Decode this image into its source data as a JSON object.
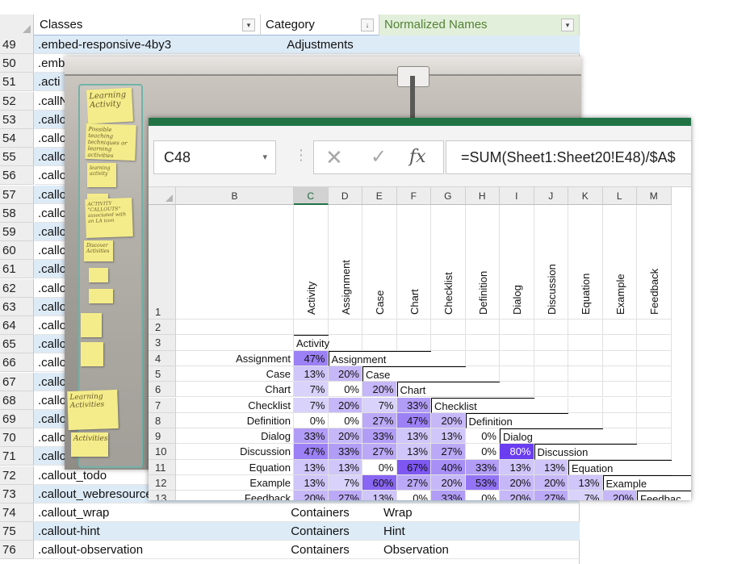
{
  "back_sheet": {
    "headers": {
      "classes": "Classes",
      "category": "Category",
      "normalized": "Normalized Names",
      "filter_icon": "▾",
      "sorted_filter_icon": "↓"
    },
    "rows": [
      {
        "num": "49",
        "cls": ".embed-responsive-4by3",
        "cat": "Adjustments",
        "norm": ""
      },
      {
        "num": "50",
        "cls": ".emb",
        "cat": "",
        "norm": ""
      },
      {
        "num": "51",
        "cls": ".acti",
        "cat": "",
        "norm": ""
      },
      {
        "num": "52",
        "cls": ".callN",
        "cat": "",
        "norm": ""
      },
      {
        "num": "53",
        "cls": ".callo",
        "cat": "",
        "norm": ""
      },
      {
        "num": "54",
        "cls": ".callo",
        "cat": "",
        "norm": ""
      },
      {
        "num": "55",
        "cls": ".callo",
        "cat": "",
        "norm": ""
      },
      {
        "num": "56",
        "cls": ".callo",
        "cat": "",
        "norm": ""
      },
      {
        "num": "57",
        "cls": ".callo",
        "cat": "",
        "norm": ""
      },
      {
        "num": "58",
        "cls": ".callo",
        "cat": "",
        "norm": ""
      },
      {
        "num": "59",
        "cls": ".callo",
        "cat": "",
        "norm": ""
      },
      {
        "num": "60",
        "cls": ".callo",
        "cat": "",
        "norm": ""
      },
      {
        "num": "61",
        "cls": ".callo",
        "cat": "",
        "norm": ""
      },
      {
        "num": "62",
        "cls": ".callo",
        "cat": "",
        "norm": ""
      },
      {
        "num": "63",
        "cls": ".callo",
        "cat": "",
        "norm": ""
      },
      {
        "num": "64",
        "cls": ".callo",
        "cat": "",
        "norm": ""
      },
      {
        "num": "65",
        "cls": ".callo",
        "cat": "",
        "norm": ""
      },
      {
        "num": "66",
        "cls": ".callo",
        "cat": "",
        "norm": ""
      },
      {
        "num": "67",
        "cls": ".callo",
        "cat": "",
        "norm": ""
      },
      {
        "num": "68",
        "cls": ".callo",
        "cat": "",
        "norm": ""
      },
      {
        "num": "69",
        "cls": ".callo",
        "cat": "",
        "norm": ""
      },
      {
        "num": "70",
        "cls": ".callo",
        "cat": "",
        "norm": ""
      },
      {
        "num": "71",
        "cls": ".callout_summary",
        "cat": "",
        "norm": ""
      },
      {
        "num": "72",
        "cls": ".callout_todo",
        "cat": "",
        "norm": ""
      },
      {
        "num": "73",
        "cls": ".callout_webresources",
        "cat": "",
        "norm": ""
      },
      {
        "num": "74",
        "cls": ".callout_wrap",
        "cat": "Containers",
        "norm": "Wrap"
      },
      {
        "num": "75",
        "cls": ".callout-hint",
        "cat": "Containers",
        "norm": "Hint"
      },
      {
        "num": "76",
        "cls": ".callout-observation",
        "cat": "Containers",
        "norm": "Observation"
      }
    ]
  },
  "photo": {
    "notes": [
      "Learning Activity",
      "Possible teaching techniques or learning activities",
      "learning activity",
      "ACTIVITY \"CALLOUTS\" associated with an LA icon",
      "Discover Activities",
      "Learning Activities",
      "Activities"
    ]
  },
  "excel": {
    "name_box": "C48",
    "name_box_arrow": "▾",
    "divider_dots": "⋮",
    "cancel_icon": "✕",
    "enter_icon": "✓",
    "fx_label": "fx",
    "formula": "=SUM(Sheet1:Sheet20!E48)/$A$",
    "col_label_b": "B",
    "columns": [
      "C",
      "D",
      "E",
      "F",
      "G",
      "H",
      "I",
      "J",
      "K",
      "L",
      "M"
    ],
    "vertical_headers": [
      "Activity",
      "Assignment",
      "Case",
      "Chart",
      "Checklist",
      "Definition",
      "Dialog",
      "Discussion",
      "Equation",
      "Example",
      "Feedback"
    ],
    "row_numbers": [
      "1",
      "2",
      "3",
      "4",
      "5",
      "6",
      "7",
      "8",
      "9",
      "10",
      "11",
      "12",
      "13"
    ],
    "row3_label": "Activity",
    "matrix_rows": [
      {
        "label": "Assignment",
        "values": [
          "47%"
        ],
        "tail": "Assignment"
      },
      {
        "label": "Case",
        "values": [
          "13%",
          "20%"
        ],
        "tail": "Case"
      },
      {
        "label": "Chart",
        "values": [
          "7%",
          "0%",
          "20%"
        ],
        "tail": "Chart"
      },
      {
        "label": "Checklist",
        "values": [
          "7%",
          "20%",
          "7%",
          "33%"
        ],
        "tail": "Checklist"
      },
      {
        "label": "Definition",
        "values": [
          "0%",
          "0%",
          "27%",
          "47%",
          "20%"
        ],
        "tail": "Definition"
      },
      {
        "label": "Dialog",
        "values": [
          "33%",
          "20%",
          "33%",
          "13%",
          "13%",
          "0%"
        ],
        "tail": "Dialog"
      },
      {
        "label": "Discussion",
        "values": [
          "47%",
          "33%",
          "27%",
          "13%",
          "27%",
          "0%",
          "80%"
        ],
        "tail": "Discussion"
      },
      {
        "label": "Equation",
        "values": [
          "13%",
          "13%",
          "0%",
          "67%",
          "40%",
          "33%",
          "13%",
          "13%"
        ],
        "tail": "Equation"
      },
      {
        "label": "Example",
        "values": [
          "13%",
          "7%",
          "60%",
          "27%",
          "20%",
          "53%",
          "20%",
          "20%",
          "13%"
        ],
        "tail": "Example"
      },
      {
        "label": "Feedback",
        "values": [
          "20%",
          "27%",
          "13%",
          "0%",
          "33%",
          "0%",
          "20%",
          "27%",
          "7%",
          "20%"
        ],
        "tail": "Feedbac"
      }
    ]
  },
  "colors": {
    "excel_green": "#217346",
    "heat_max": "#6a3df0",
    "heat_light": "#e4e0fb"
  }
}
